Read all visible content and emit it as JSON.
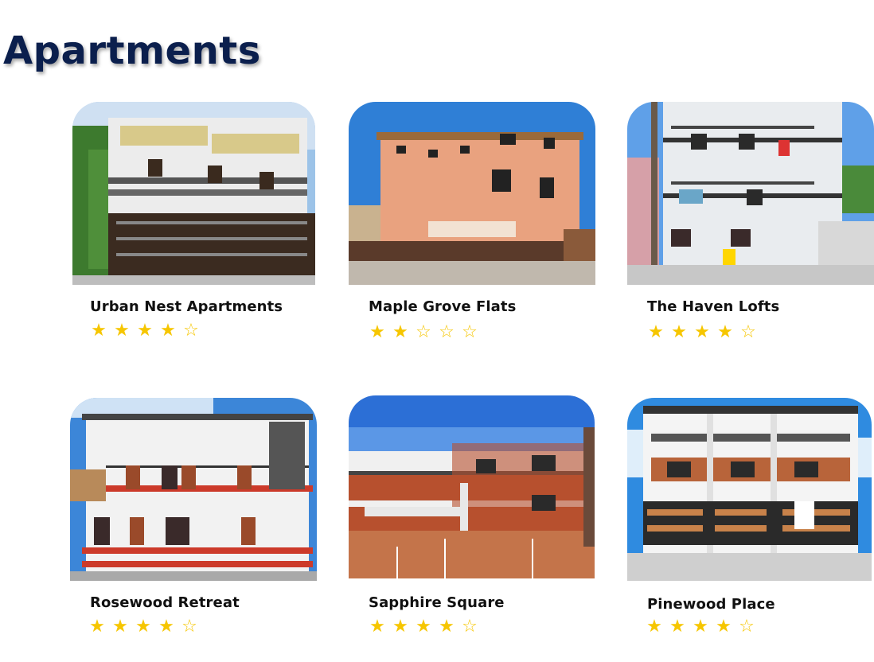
{
  "page": {
    "title": "Apartments"
  },
  "apartments": [
    {
      "name": "Urban Nest Apartments",
      "rating": 4,
      "max_rating": 5
    },
    {
      "name": "Maple Grove Flats",
      "rating": 2,
      "max_rating": 5
    },
    {
      "name": "The Haven Lofts",
      "rating": 4,
      "max_rating": 5
    },
    {
      "name": "Rosewood Retreat",
      "rating": 4,
      "max_rating": 5
    },
    {
      "name": "Sapphire Square",
      "rating": 4,
      "max_rating": 5
    },
    {
      "name": "Pinewood Place",
      "rating": 4,
      "max_rating": 5
    }
  ],
  "icons": {
    "filled_star": "★",
    "empty_star": "☆"
  },
  "colors": {
    "title": "#0b1f4d",
    "star": "#f6c600"
  }
}
